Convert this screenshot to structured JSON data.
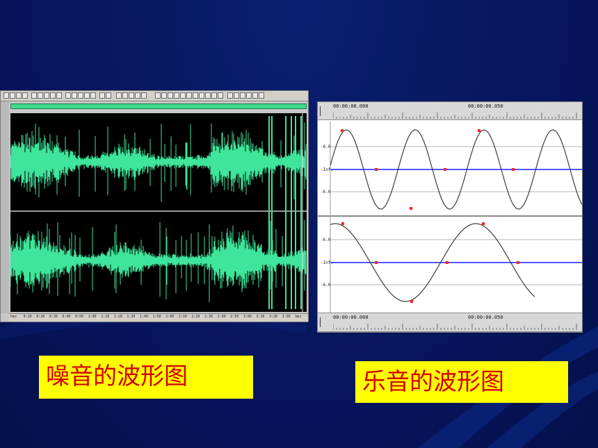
{
  "noise_editor": {
    "time_ruler_labels": [
      "hms",
      "0:10",
      "0:20",
      "0:30",
      "0:40",
      "0:50",
      "1:00",
      "1:10",
      "1:20",
      "1:30",
      "1:40",
      "1:50",
      "2:00",
      "2:10",
      "2:20",
      "2:30",
      "2:40",
      "2:50",
      "3:00",
      "3:10",
      "3:20",
      "3:30",
      "hms"
    ]
  },
  "music_editor": {
    "top_ruler": {
      "start": "00:00:00.000",
      "mid": "00:00:00.050"
    },
    "bottom_ruler": {
      "start": "00:00:00.000",
      "mid": "00:00:00.050"
    },
    "upper_track_labels": [
      "-6.0",
      "-Inf.",
      "-6.0"
    ],
    "lower_track_labels": [
      "-6.0",
      "-Inf.",
      "-6.0"
    ]
  },
  "captions": {
    "noise": "噪音的波形图",
    "music": "乐音的波形图"
  },
  "colors": {
    "noise_wave": "#3ee59a",
    "music_wave": "#3a3a3a",
    "center_line": "#1a1aff",
    "marker": "#ff2020",
    "caption_bg": "#ffff00",
    "caption_text": "#d40000"
  }
}
